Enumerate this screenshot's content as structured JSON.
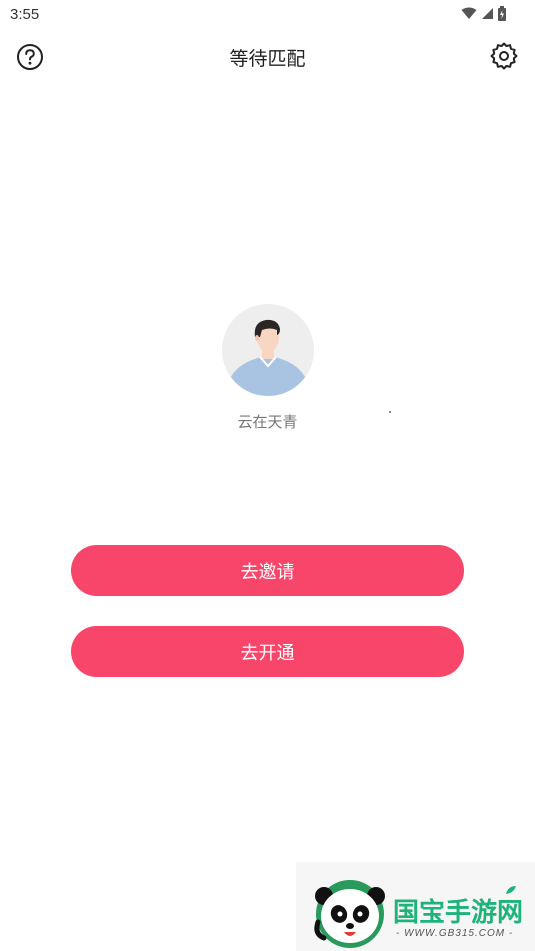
{
  "status_bar": {
    "time": "3:55",
    "icons": [
      "wifi-icon",
      "signal-icon",
      "battery-icon"
    ]
  },
  "header": {
    "title": "等待匹配",
    "left_icon": "help-icon",
    "right_icon": "gear-icon"
  },
  "profile": {
    "avatar_icon": "user-avatar-icon",
    "nickname": "云在天青"
  },
  "actions": {
    "invite_label": "去邀请",
    "open_label": "去开通",
    "button_color": "#f7466a"
  },
  "watermark": {
    "title": "国宝手游网",
    "url": "- WWW.GB315.COM -",
    "brand_color": "#1fb27a"
  }
}
